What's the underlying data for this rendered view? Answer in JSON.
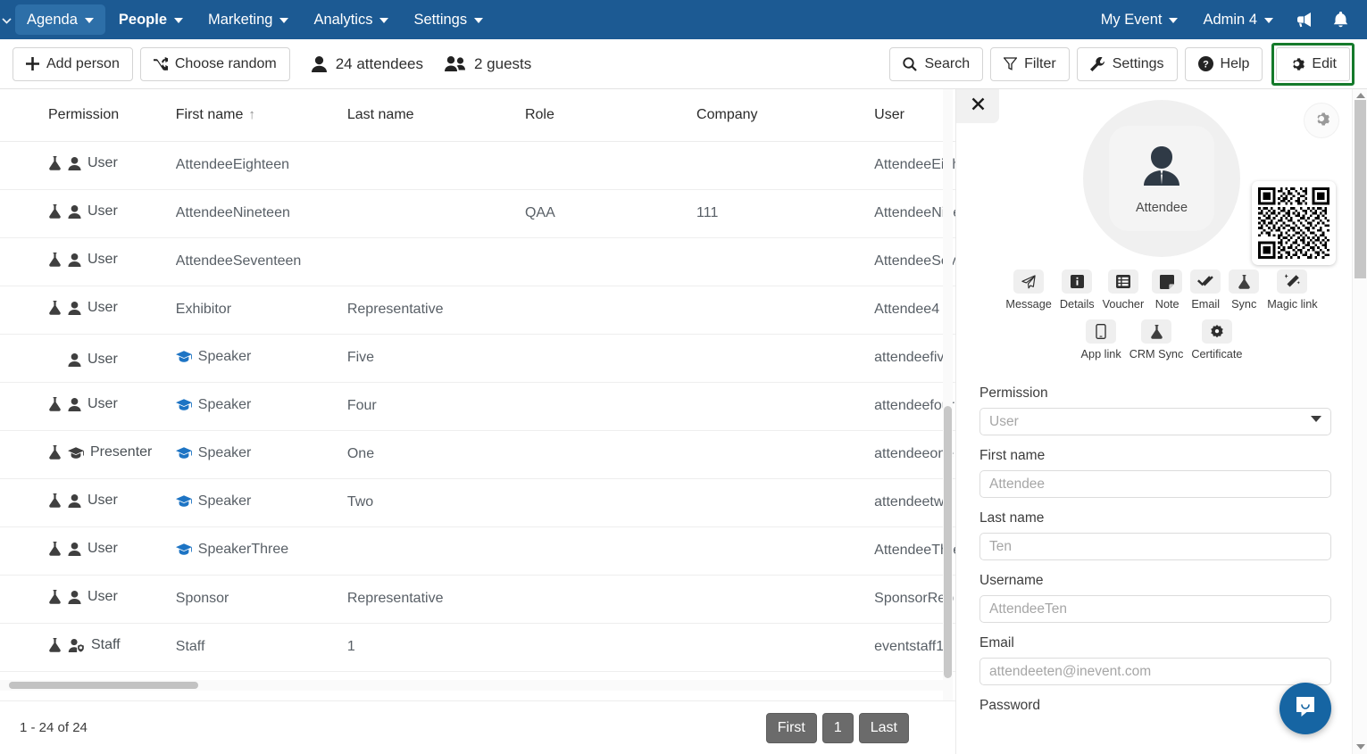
{
  "nav": {
    "left_items": [
      {
        "label": "Agenda",
        "active": true,
        "bold": false
      },
      {
        "label": "People",
        "active": false,
        "bold": true
      },
      {
        "label": "Marketing",
        "active": false,
        "bold": false
      },
      {
        "label": "Analytics",
        "active": false,
        "bold": false
      },
      {
        "label": "Settings",
        "active": false,
        "bold": false
      }
    ],
    "right_items": [
      {
        "label": "My Event"
      },
      {
        "label": "Admin 4"
      }
    ],
    "icons": [
      "megaphone-icon",
      "bell-icon"
    ],
    "bar_color": "#1c5a93",
    "active_color": "#2d6fa8"
  },
  "toolbar": {
    "add_person": "Add person",
    "choose_random": "Choose random",
    "attendees_count": "24 attendees",
    "guests_count": "2 guests",
    "search": "Search",
    "filter": "Filter",
    "settings": "Settings",
    "help": "Help",
    "edit": "Edit",
    "edit_highlight_color": "#157a2b"
  },
  "table": {
    "columns": [
      "Permission",
      "First name",
      "Last name",
      "Role",
      "Company",
      "User"
    ],
    "sort_column": "First name",
    "sort_arrow": "↑",
    "rows": [
      {
        "flask": true,
        "perm_icon": "user-icon",
        "permission": "User",
        "first_name": "AttendeeEighteen",
        "first_icon": "",
        "last_name": "",
        "role": "",
        "company": "",
        "user": "AttendeeEighteen"
      },
      {
        "flask": true,
        "perm_icon": "user-icon",
        "permission": "User",
        "first_name": "AttendeeNineteen",
        "first_icon": "",
        "last_name": "",
        "role": "QAA",
        "company": "111",
        "user": "AttendeeNineteen"
      },
      {
        "flask": true,
        "perm_icon": "user-icon",
        "permission": "User",
        "first_name": "AttendeeSeventeen",
        "first_icon": "",
        "last_name": "",
        "role": "",
        "company": "",
        "user": "AttendeeSeventeen"
      },
      {
        "flask": true,
        "perm_icon": "user-icon",
        "permission": "User",
        "first_name": "Exhibitor",
        "first_icon": "",
        "last_name": "Representative",
        "role": "",
        "company": "",
        "user": "Attendee4"
      },
      {
        "flask": false,
        "perm_icon": "user-icon",
        "permission": "User",
        "first_name": "Speaker",
        "first_icon": "cap-icon",
        "last_name": "Five",
        "role": "",
        "company": "",
        "user": "attendeefive"
      },
      {
        "flask": true,
        "perm_icon": "user-icon",
        "permission": "User",
        "first_name": "Speaker",
        "first_icon": "cap-icon",
        "last_name": "Four",
        "role": "",
        "company": "",
        "user": "attendeefour"
      },
      {
        "flask": true,
        "perm_icon": "cap-dark-icon",
        "permission": "Presenter",
        "first_name": "Speaker",
        "first_icon": "cap-icon",
        "last_name": "One",
        "role": "",
        "company": "",
        "user": "attendeeone"
      },
      {
        "flask": true,
        "perm_icon": "user-icon",
        "permission": "User",
        "first_name": "Speaker",
        "first_icon": "cap-icon",
        "last_name": "Two",
        "role": "",
        "company": "",
        "user": "attendeetwo"
      },
      {
        "flask": true,
        "perm_icon": "user-icon",
        "permission": "User",
        "first_name": "SpeakerThree",
        "first_icon": "cap-icon",
        "last_name": "",
        "role": "",
        "company": "",
        "user": "AttendeeThre"
      },
      {
        "flask": true,
        "perm_icon": "user-icon",
        "permission": "User",
        "first_name": "Sponsor",
        "first_icon": "",
        "last_name": "Representative",
        "role": "",
        "company": "",
        "user": "SponsorRep"
      },
      {
        "flask": true,
        "perm_icon": "user-shield-icon",
        "permission": "Staff",
        "first_name": "Staff",
        "first_icon": "",
        "last_name": "1",
        "role": "",
        "company": "",
        "user": "eventstaff1"
      }
    ]
  },
  "pagination": {
    "info": "1 - 24 of 24",
    "first": "First",
    "current": "1",
    "last": "Last"
  },
  "panel": {
    "avatar_label": "Attendee",
    "actions_row1": [
      {
        "label": "Message",
        "icon": "paper-plane-icon"
      },
      {
        "label": "Details",
        "icon": "info-icon"
      },
      {
        "label": "Voucher",
        "icon": "list-icon"
      },
      {
        "label": "Note",
        "icon": "note-icon"
      },
      {
        "label": "Email",
        "icon": "double-check-icon"
      },
      {
        "label": "Sync",
        "icon": "flask-icon"
      },
      {
        "label": "Magic link",
        "icon": "magic-wand-icon"
      }
    ],
    "actions_row2": [
      {
        "label": "App link",
        "icon": "mobile-icon"
      },
      {
        "label": "CRM Sync",
        "icon": "flask-icon"
      },
      {
        "label": "Certificate",
        "icon": "badge-icon"
      }
    ],
    "fields": [
      {
        "label": "Permission",
        "value": "User",
        "type": "select"
      },
      {
        "label": "First name",
        "value": "Attendee",
        "type": "text"
      },
      {
        "label": "Last name",
        "value": "Ten",
        "type": "text"
      },
      {
        "label": "Username",
        "value": "AttendeeTen",
        "type": "text"
      },
      {
        "label": "Email",
        "value": "attendeeten@inevent.com",
        "type": "text"
      },
      {
        "label": "Password",
        "value": "",
        "type": "label-only"
      }
    ]
  }
}
